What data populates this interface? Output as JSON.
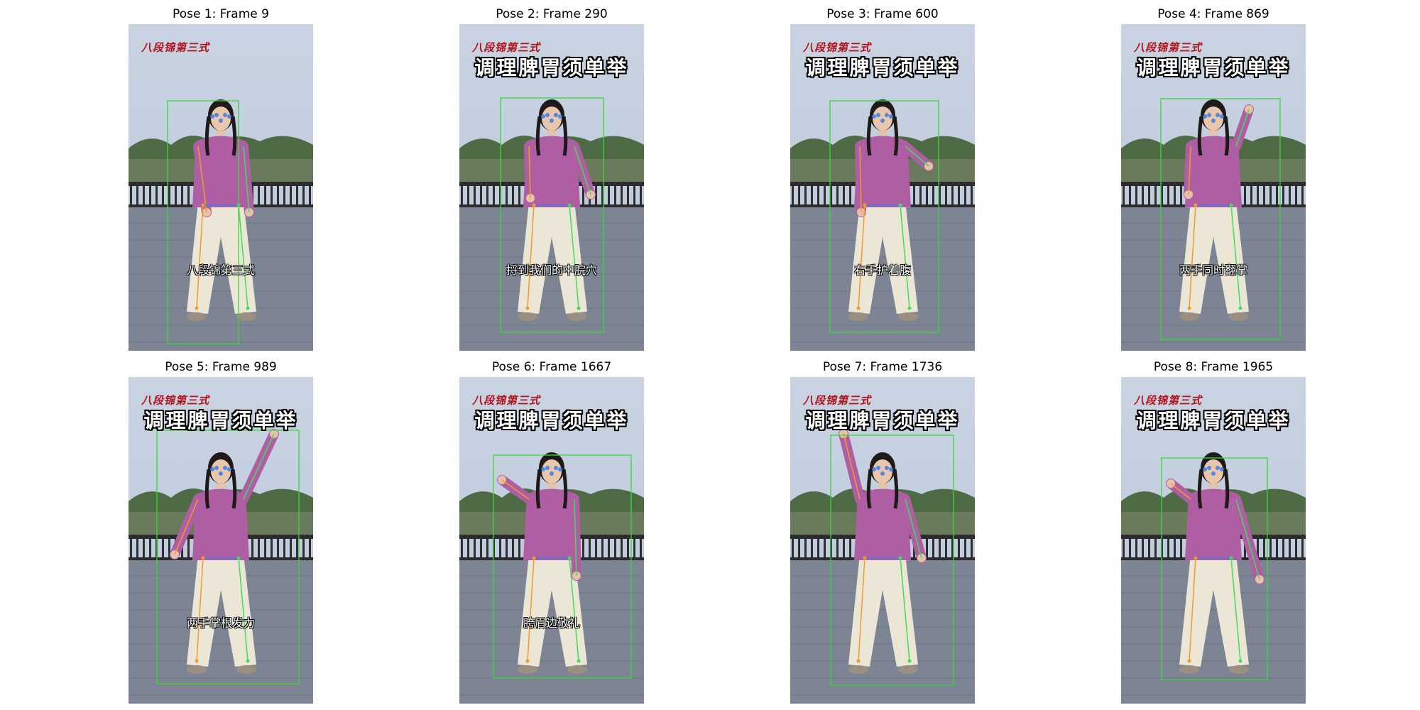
{
  "poses": [
    {
      "title": "Pose 1: Frame 9",
      "caption_small": "八段锦第三式",
      "caption_big": "",
      "subtitle": "八段锦第三式"
    },
    {
      "title": "Pose 2: Frame 290",
      "caption_small": "八段锦第三式",
      "caption_big": "调理脾胃须单举",
      "subtitle": "捋到我们的中脘穴"
    },
    {
      "title": "Pose 3: Frame 600",
      "caption_small": "八段锦第三式",
      "caption_big": "调理脾胃须单举",
      "subtitle": "右手护着腹"
    },
    {
      "title": "Pose 4: Frame 869",
      "caption_small": "八段锦第三式",
      "caption_big": "调理脾胃须单举",
      "subtitle": "两手同时翻掌"
    },
    {
      "title": "Pose 5: Frame 989",
      "caption_small": "八段锦第三式",
      "caption_big": "调理脾胃须单举",
      "subtitle": "两手掌根发力"
    },
    {
      "title": "Pose 6: Frame 1667",
      "caption_small": "八段锦第三式",
      "caption_big": "调理脾胃须单举",
      "subtitle": "胯眉边敬礼"
    },
    {
      "title": "Pose 7: Frame 1736",
      "caption_small": "八段锦第三式",
      "caption_big": "调理脾胃须单举",
      "subtitle": ""
    },
    {
      "title": "Pose 8: Frame 1965",
      "caption_small": "八段锦第三式",
      "caption_big": "调理脾胃须单举",
      "subtitle": ""
    }
  ],
  "colors": {
    "bounding_box": "#39d839",
    "skeleton_left": "#f39a2c",
    "skeleton_right": "#3ce05a",
    "face_keypoints": "#3a7be8",
    "shirt": "#b05ea3",
    "pants": "#ece6d6",
    "sky": "#b9c6d8",
    "ground": "#7d8594"
  }
}
